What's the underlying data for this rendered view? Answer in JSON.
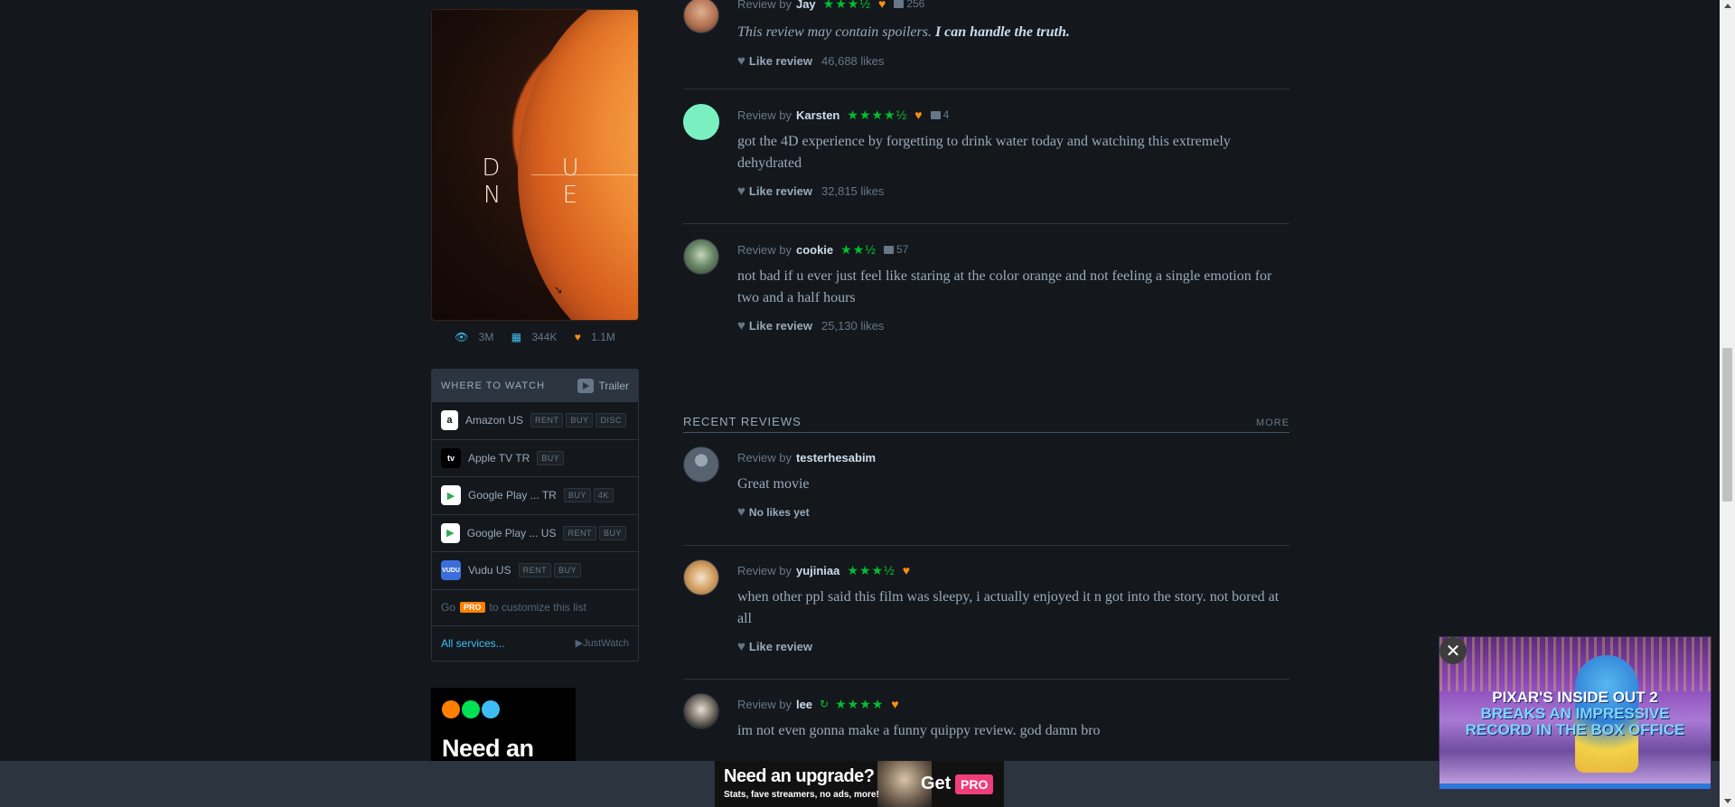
{
  "film": {
    "poster_title": "D U N E",
    "stats": {
      "watched": "3M",
      "lists": "344K",
      "likes": "1.1M"
    }
  },
  "where_to_watch": {
    "heading": "WHERE TO WATCH",
    "trailer_label": "Trailer",
    "services": [
      {
        "name": "Amazon US",
        "logo": "a",
        "tags": [
          "RENT",
          "BUY",
          "DISC"
        ]
      },
      {
        "name": "Apple TV TR",
        "logo": "tv",
        "tags": [
          "BUY"
        ]
      },
      {
        "name": "Google Play ...  TR",
        "logo": "▶",
        "tags": [
          "BUY",
          "4K"
        ]
      },
      {
        "name": "Google Play ...  US",
        "logo": "▶",
        "tags": [
          "RENT",
          "BUY"
        ]
      },
      {
        "name": "Vudu US",
        "logo": "VUDU",
        "tags": [
          "RENT",
          "BUY"
        ]
      }
    ],
    "pro_prefix": "Go",
    "pro_badge": "PRO",
    "pro_suffix": "to customize this list",
    "all_services": "All services...",
    "justwatch": "JustWatch"
  },
  "sidebar_promo": {
    "text": "Need an"
  },
  "reviews_popular": [
    {
      "by": "Review by",
      "author": "Jay",
      "stars": "★★★½",
      "liked": true,
      "comments": "256",
      "spoiler_text": "This review may contain spoilers.",
      "spoiler_link": "I can handle the truth.",
      "like_label": "Like review",
      "likes": "46,688 likes"
    },
    {
      "by": "Review by",
      "author": "Karsten",
      "stars": "★★★★½",
      "liked": true,
      "comments": "4",
      "text": "got the 4D experience by forgetting to drink water today and watching this extremely dehydrated",
      "like_label": "Like review",
      "likes": "32,815 likes"
    },
    {
      "by": "Review by",
      "author": "cookie",
      "stars": "★★½",
      "liked": false,
      "comments": "57",
      "text": "not bad if u ever just feel like staring at the color orange and not feeling a single emotion for two and a half hours",
      "like_label": "Like review",
      "likes": "25,130 likes"
    }
  ],
  "recent_section": {
    "title": "RECENT REVIEWS",
    "more": "MORE"
  },
  "reviews_recent": [
    {
      "by": "Review by",
      "author": "testerhesabim",
      "text": "Great movie",
      "no_likes": "No likes yet"
    },
    {
      "by": "Review by",
      "author": "yujiniaa",
      "stars": "★★★½",
      "liked": true,
      "text": "when other ppl said this film was sleepy, i actually enjoyed it n got into the story. not bored at all",
      "like_label": "Like review"
    },
    {
      "by": "Review by",
      "author": "lee",
      "stars": "★★★★",
      "liked": true,
      "rewatch": true,
      "text": "im not even gonna make a funny quippy review. god damn bro"
    }
  ],
  "bottom_ad": {
    "line1": "Need an upgrade?",
    "line2": "Stats, fave streamers, no ads, more!",
    "get": "Get",
    "pro": "PRO"
  },
  "float_ad": {
    "line1": "PIXAR'S INSIDE OUT 2",
    "line2": "BREAKS AN IMPRESSIVE",
    "line3": "RECORD IN THE BOX OFFICE",
    "close": "✕"
  },
  "colors": {
    "green": "#00c030",
    "orange": "#ff9010",
    "blue": "#40bcf4",
    "pro": "#ef3f7a"
  }
}
